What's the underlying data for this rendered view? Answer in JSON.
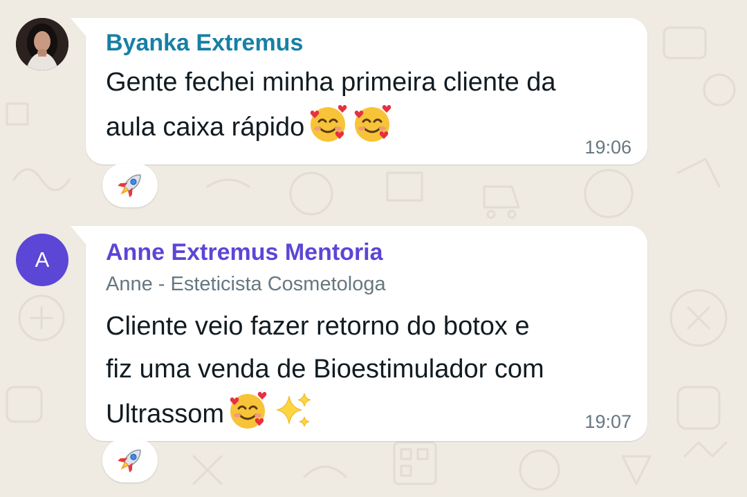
{
  "messages": [
    {
      "sender": "Byanka Extremus",
      "sender_color": "#1780a5",
      "avatar_icon": "profile-photo",
      "lines": [
        "Gente fechei minha primeira cliente da",
        "aula caixa rápido"
      ],
      "trailing_emojis": [
        "smiling-face-with-hearts-icon",
        "smiling-face-with-hearts-icon"
      ],
      "time": "19:06",
      "reaction_icon": "rocket-icon"
    },
    {
      "sender": "Anne Extremus Mentoria",
      "sender_color": "#5b46d6",
      "avatar_letter": "A",
      "subtitle": "Anne - Esteticista Cosmetologa",
      "lines": [
        "Cliente veio fazer retorno do botox e",
        "fiz uma venda de Bioestimulador com",
        "Ultrassom"
      ],
      "trailing_emojis": [
        "smiling-face-with-hearts-icon",
        "sparkles-icon"
      ],
      "time": "19:07",
      "reaction_icon": "rocket-icon"
    }
  ],
  "colors": {
    "chat_background": "#efeae2",
    "bubble": "#ffffff",
    "meta_text": "#667781",
    "body_text": "#111b21"
  }
}
